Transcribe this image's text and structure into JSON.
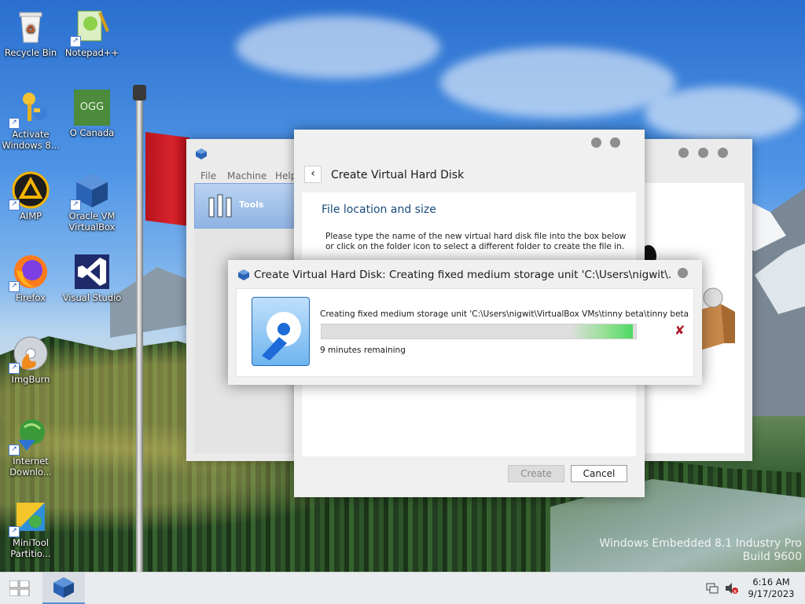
{
  "desktop": {
    "icons": [
      {
        "label": "Recycle Bin"
      },
      {
        "label": "Notepad++"
      },
      {
        "label": "Activate Windows 8..."
      },
      {
        "label": "O Canada"
      },
      {
        "label": "AIMP"
      },
      {
        "label": "Oracle VM VirtualBox"
      },
      {
        "label": "Firefox"
      },
      {
        "label": "Visual Studio"
      },
      {
        "label": "ImgBurn"
      },
      {
        "label": "Internet Downlo..."
      },
      {
        "label": "MiniTool Partitio..."
      }
    ],
    "ogg_badge": "OGG",
    "watermark_line1": "Windows Embedded 8.1 Industry Pro",
    "watermark_line2": "Build 9600"
  },
  "vbox_manager": {
    "menu": [
      "File",
      "Machine",
      "Help"
    ],
    "tools_label": "Tools"
  },
  "wizard": {
    "title": "Create Virtual Hard Disk",
    "section_title": "File location and size",
    "description": "Please type the name of the new virtual hard disk file into the box below or click on the folder icon to select a different folder to create the file in.",
    "create_label": "Create",
    "cancel_label": "Cancel"
  },
  "progress_dialog": {
    "title": "Create Virtual Hard Disk: Creating fixed medium storage unit 'C:\\Users\\nigwit\\...",
    "message": "Creating fixed medium storage unit 'C:\\Users\\nigwit\\VirtualBox VMs\\tinny beta\\tinny beta.vhd' ...",
    "remaining": "9 minutes remaining",
    "progress_fraction": 0.99,
    "accent_color": "#4cd964"
  },
  "taskbar": {
    "time": "6:16 AM",
    "date": "9/17/2023"
  }
}
